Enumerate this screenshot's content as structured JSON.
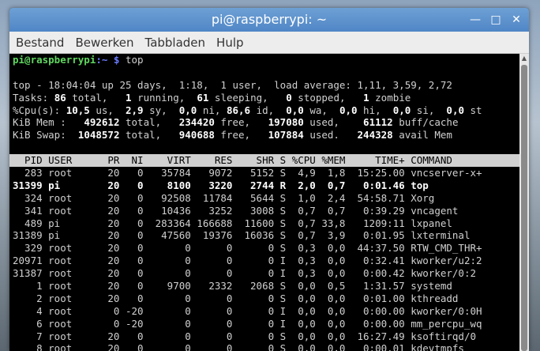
{
  "window": {
    "title": "pi@raspberrypi: ~"
  },
  "icons": {
    "minimize": "minimize-icon",
    "maximize": "maximize-icon",
    "close": "close-icon",
    "scroll_up": "scroll-up-arrow-icon"
  },
  "menu": [
    "Bestand",
    "Bewerken",
    "Tabbladen",
    "Hulp"
  ],
  "prompt": {
    "user_host": "pi@raspberrypi",
    "path": ":~ $ ",
    "command": "top"
  },
  "summary": {
    "top": "top - 18:04:04 up 25 days,  1:18,  1 user,  load average: 1,11, 3,59, 2,72",
    "tasks": {
      "label": "Tasks: ",
      "total": "86",
      "total_l": " total,   ",
      "running": "1",
      "running_l": " running,  ",
      "sleeping": "61",
      "sleeping_l": " sleeping,   ",
      "stopped": "0",
      "stopped_l": " stopped,   ",
      "zombie": "1",
      "zombie_l": " zombie"
    },
    "cpu": {
      "label": "%Cpu(s): ",
      "us": "10,5",
      "us_l": " us,  ",
      "sy": "2,9",
      "sy_l": " sy,  ",
      "ni": "0,0",
      "ni_l": " ni, ",
      "id": "86,6",
      "id_l": " id,  ",
      "wa": "0,0",
      "wa_l": " wa,  ",
      "hi": "0,0",
      "hi_l": " hi,  ",
      "si": "0,0",
      "si_l": " si,  ",
      "st": "0,0",
      "st_l": " st"
    },
    "mem": {
      "label": "KiB Mem :   ",
      "total": "492612",
      "total_l": " total,   ",
      "free": "234420",
      "free_l": " free,   ",
      "used": "197080",
      "used_l": " used,    ",
      "cache": "61112",
      "cache_l": " buff/cache"
    },
    "swap": {
      "label": "KiB Swap:  ",
      "total": "1048572",
      "total_l": " total,   ",
      "free": "940688",
      "free_l": " free,   ",
      "used": "107884",
      "used_l": " used.   ",
      "avail": "244328",
      "avail_l": " avail Mem"
    }
  },
  "table": {
    "header": "  PID USER      PR  NI    VIRT    RES    SHR S %CPU %MEM     TIME+ COMMAND       ",
    "rows": [
      "  283 root      20   0   35784   9072   5152 S  4,9  1,8  15:25.00 vncserver-x+",
      "31399 pi        20   0    8100   3220   2744 R  2,0  0,7   0:01.46 top",
      "  324 root      20   0   92508  11784   5644 S  1,0  2,4  54:58.71 Xorg",
      "  341 root      20   0   10436   3252   3008 S  0,7  0,7   0:39.29 vncagent",
      "  489 pi        20   0  283364 166688  11600 S  0,7 33,8   1209:11 lxpanel",
      "31389 pi        20   0   47560  19376  16036 S  0,7  3,9   0:01.95 lxterminal",
      "  329 root      20   0       0      0      0 S  0,3  0,0  44:37.50 RTW_CMD_THR+",
      "20971 root      20   0       0      0      0 I  0,3  0,0   0:32.41 kworker/u2:2",
      "31387 root      20   0       0      0      0 I  0,3  0,0   0:00.42 kworker/0:2",
      "    1 root      20   0    9700   2332   2068 S  0,0  0,5   1:31.57 systemd",
      "    2 root      20   0       0      0      0 S  0,0  0,0   0:01.00 kthreadd",
      "    4 root       0 -20       0      0      0 I  0,0  0,0   0:00.00 kworker/0:0H",
      "    6 root       0 -20       0      0      0 I  0,0  0,0   0:00.00 mm_percpu_wq",
      "    7 root      20   0       0      0      0 S  0,0  0,0  16:27.49 ksoftirqd/0",
      "    8 root      20   0       0      0      0 S  0,0  0,0   0:00.01 kdevtmpfs"
    ],
    "bold_row_index": 1
  }
}
